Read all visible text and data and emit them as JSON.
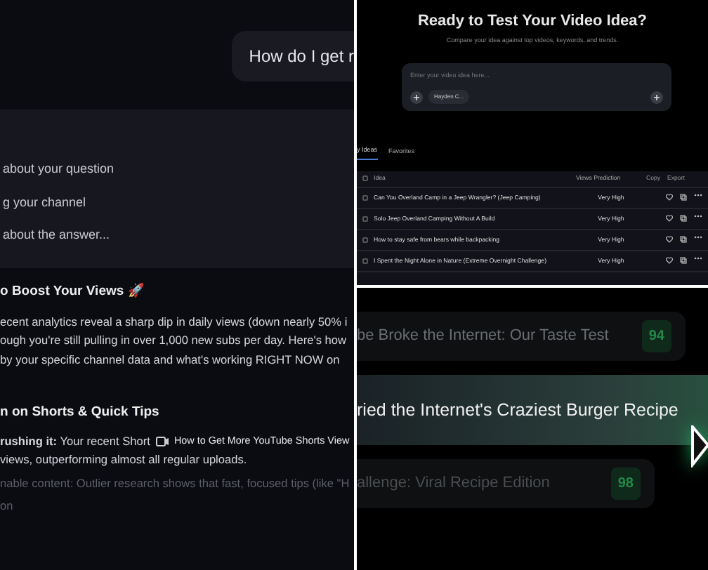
{
  "chat_panel": {
    "user_message": "How do I get r",
    "thinking_steps": [
      "about your question",
      "g your channel",
      "about the answer..."
    ],
    "heading": "o Boost Your Views 🚀",
    "paragraph_lines": [
      "ecent analytics reveal a sharp dip in daily views (down nearly 50% i",
      "ough you're still pulling in over 1,000 new subs per day. Here's how",
      "by your specific channel data and what's working RIGHT NOW on"
    ],
    "section_heading": "n on Shorts & Quick Tips",
    "bullet_lines": [
      {
        "text": "**rushing it:** Your recent Short",
        "link": "How to Get More YouTube Shorts View",
        "faded": false
      },
      {
        "text": "views, outperforming almost all regular uploads.",
        "faded": false
      },
      {
        "text": "nable content: Outlier research shows that fast, focused tips (like \"H",
        "faded": true
      },
      {
        "text": "on",
        "faded": true
      }
    ]
  },
  "idea_panel": {
    "title": "Ready to Test Your Video Idea?",
    "subtitle": "Compare your idea against top videos, keywords, and trends.",
    "input": {
      "placeholder": "Enter your video idea here..."
    },
    "channel_chip": "Hayden C...",
    "tabs": [
      {
        "label": "y Ideas",
        "selected": true
      },
      {
        "label": "Favorites",
        "selected": false
      }
    ],
    "select_all_checked": false,
    "columns": [
      "Idea",
      "Views Prediction"
    ],
    "actions": [
      "Copy",
      "Export"
    ],
    "rows": [
      {
        "idea": "Can You Overland Camp in a Jeep Wrangler? (Jeep Camping)",
        "prediction": "Very High",
        "checked": false
      },
      {
        "idea": "Solo Jeep Overland Camping Without A Build",
        "prediction": "Very High",
        "checked": false
      },
      {
        "idea": "How to stay safe from bears while backpacking",
        "prediction": "Very High",
        "checked": false
      },
      {
        "idea": "I Spent the Night Alone in Nature (Extreme Overnight Challenge)",
        "prediction": "Very High",
        "checked": false
      }
    ]
  },
  "ranked_list": {
    "items": [
      {
        "title": "be Broke the Internet: Our Taste Test",
        "score": "94",
        "selected": false
      },
      {
        "title": "ried the Internet's Craziest Burger Recipe",
        "selected": true
      },
      {
        "title": "allenge: Viral Recipe Edition",
        "score": "98",
        "selected": false
      }
    ]
  }
}
